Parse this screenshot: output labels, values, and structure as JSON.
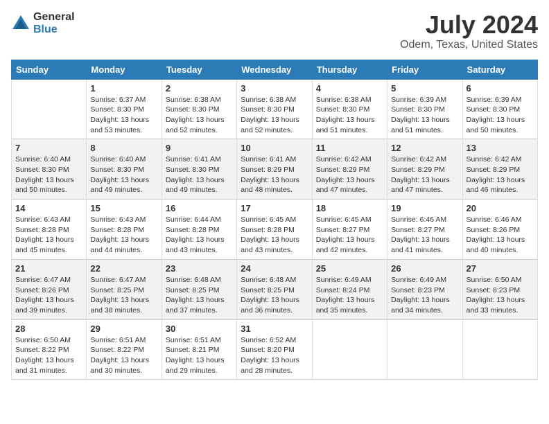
{
  "logo": {
    "general": "General",
    "blue": "Blue"
  },
  "title": "July 2024",
  "subtitle": "Odem, Texas, United States",
  "headers": [
    "Sunday",
    "Monday",
    "Tuesday",
    "Wednesday",
    "Thursday",
    "Friday",
    "Saturday"
  ],
  "weeks": [
    [
      {
        "day": "",
        "sunrise": "",
        "sunset": "",
        "daylight": ""
      },
      {
        "day": "1",
        "sunrise": "Sunrise: 6:37 AM",
        "sunset": "Sunset: 8:30 PM",
        "daylight": "Daylight: 13 hours and 53 minutes."
      },
      {
        "day": "2",
        "sunrise": "Sunrise: 6:38 AM",
        "sunset": "Sunset: 8:30 PM",
        "daylight": "Daylight: 13 hours and 52 minutes."
      },
      {
        "day": "3",
        "sunrise": "Sunrise: 6:38 AM",
        "sunset": "Sunset: 8:30 PM",
        "daylight": "Daylight: 13 hours and 52 minutes."
      },
      {
        "day": "4",
        "sunrise": "Sunrise: 6:38 AM",
        "sunset": "Sunset: 8:30 PM",
        "daylight": "Daylight: 13 hours and 51 minutes."
      },
      {
        "day": "5",
        "sunrise": "Sunrise: 6:39 AM",
        "sunset": "Sunset: 8:30 PM",
        "daylight": "Daylight: 13 hours and 51 minutes."
      },
      {
        "day": "6",
        "sunrise": "Sunrise: 6:39 AM",
        "sunset": "Sunset: 8:30 PM",
        "daylight": "Daylight: 13 hours and 50 minutes."
      }
    ],
    [
      {
        "day": "7",
        "sunrise": "Sunrise: 6:40 AM",
        "sunset": "Sunset: 8:30 PM",
        "daylight": "Daylight: 13 hours and 50 minutes."
      },
      {
        "day": "8",
        "sunrise": "Sunrise: 6:40 AM",
        "sunset": "Sunset: 8:30 PM",
        "daylight": "Daylight: 13 hours and 49 minutes."
      },
      {
        "day": "9",
        "sunrise": "Sunrise: 6:41 AM",
        "sunset": "Sunset: 8:30 PM",
        "daylight": "Daylight: 13 hours and 49 minutes."
      },
      {
        "day": "10",
        "sunrise": "Sunrise: 6:41 AM",
        "sunset": "Sunset: 8:29 PM",
        "daylight": "Daylight: 13 hours and 48 minutes."
      },
      {
        "day": "11",
        "sunrise": "Sunrise: 6:42 AM",
        "sunset": "Sunset: 8:29 PM",
        "daylight": "Daylight: 13 hours and 47 minutes."
      },
      {
        "day": "12",
        "sunrise": "Sunrise: 6:42 AM",
        "sunset": "Sunset: 8:29 PM",
        "daylight": "Daylight: 13 hours and 47 minutes."
      },
      {
        "day": "13",
        "sunrise": "Sunrise: 6:42 AM",
        "sunset": "Sunset: 8:29 PM",
        "daylight": "Daylight: 13 hours and 46 minutes."
      }
    ],
    [
      {
        "day": "14",
        "sunrise": "Sunrise: 6:43 AM",
        "sunset": "Sunset: 8:28 PM",
        "daylight": "Daylight: 13 hours and 45 minutes."
      },
      {
        "day": "15",
        "sunrise": "Sunrise: 6:43 AM",
        "sunset": "Sunset: 8:28 PM",
        "daylight": "Daylight: 13 hours and 44 minutes."
      },
      {
        "day": "16",
        "sunrise": "Sunrise: 6:44 AM",
        "sunset": "Sunset: 8:28 PM",
        "daylight": "Daylight: 13 hours and 43 minutes."
      },
      {
        "day": "17",
        "sunrise": "Sunrise: 6:45 AM",
        "sunset": "Sunset: 8:28 PM",
        "daylight": "Daylight: 13 hours and 43 minutes."
      },
      {
        "day": "18",
        "sunrise": "Sunrise: 6:45 AM",
        "sunset": "Sunset: 8:27 PM",
        "daylight": "Daylight: 13 hours and 42 minutes."
      },
      {
        "day": "19",
        "sunrise": "Sunrise: 6:46 AM",
        "sunset": "Sunset: 8:27 PM",
        "daylight": "Daylight: 13 hours and 41 minutes."
      },
      {
        "day": "20",
        "sunrise": "Sunrise: 6:46 AM",
        "sunset": "Sunset: 8:26 PM",
        "daylight": "Daylight: 13 hours and 40 minutes."
      }
    ],
    [
      {
        "day": "21",
        "sunrise": "Sunrise: 6:47 AM",
        "sunset": "Sunset: 8:26 PM",
        "daylight": "Daylight: 13 hours and 39 minutes."
      },
      {
        "day": "22",
        "sunrise": "Sunrise: 6:47 AM",
        "sunset": "Sunset: 8:25 PM",
        "daylight": "Daylight: 13 hours and 38 minutes."
      },
      {
        "day": "23",
        "sunrise": "Sunrise: 6:48 AM",
        "sunset": "Sunset: 8:25 PM",
        "daylight": "Daylight: 13 hours and 37 minutes."
      },
      {
        "day": "24",
        "sunrise": "Sunrise: 6:48 AM",
        "sunset": "Sunset: 8:25 PM",
        "daylight": "Daylight: 13 hours and 36 minutes."
      },
      {
        "day": "25",
        "sunrise": "Sunrise: 6:49 AM",
        "sunset": "Sunset: 8:24 PM",
        "daylight": "Daylight: 13 hours and 35 minutes."
      },
      {
        "day": "26",
        "sunrise": "Sunrise: 6:49 AM",
        "sunset": "Sunset: 8:23 PM",
        "daylight": "Daylight: 13 hours and 34 minutes."
      },
      {
        "day": "27",
        "sunrise": "Sunrise: 6:50 AM",
        "sunset": "Sunset: 8:23 PM",
        "daylight": "Daylight: 13 hours and 33 minutes."
      }
    ],
    [
      {
        "day": "28",
        "sunrise": "Sunrise: 6:50 AM",
        "sunset": "Sunset: 8:22 PM",
        "daylight": "Daylight: 13 hours and 31 minutes."
      },
      {
        "day": "29",
        "sunrise": "Sunrise: 6:51 AM",
        "sunset": "Sunset: 8:22 PM",
        "daylight": "Daylight: 13 hours and 30 minutes."
      },
      {
        "day": "30",
        "sunrise": "Sunrise: 6:51 AM",
        "sunset": "Sunset: 8:21 PM",
        "daylight": "Daylight: 13 hours and 29 minutes."
      },
      {
        "day": "31",
        "sunrise": "Sunrise: 6:52 AM",
        "sunset": "Sunset: 8:20 PM",
        "daylight": "Daylight: 13 hours and 28 minutes."
      },
      {
        "day": "",
        "sunrise": "",
        "sunset": "",
        "daylight": ""
      },
      {
        "day": "",
        "sunrise": "",
        "sunset": "",
        "daylight": ""
      },
      {
        "day": "",
        "sunrise": "",
        "sunset": "",
        "daylight": ""
      }
    ]
  ]
}
